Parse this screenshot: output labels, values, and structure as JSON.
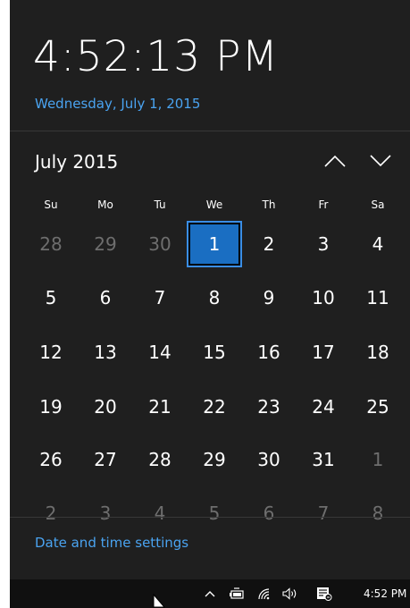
{
  "clock": {
    "time": "4:52:13 PM",
    "date": "Wednesday, July 1, 2015"
  },
  "calendar": {
    "month_title": "July 2015",
    "weekdays": [
      "Su",
      "Mo",
      "Tu",
      "We",
      "Th",
      "Fr",
      "Sa"
    ],
    "weeks": [
      [
        "28",
        "29",
        "30",
        "1",
        "2",
        "3",
        "4"
      ],
      [
        "5",
        "6",
        "7",
        "8",
        "9",
        "10",
        "11"
      ],
      [
        "12",
        "13",
        "14",
        "15",
        "16",
        "17",
        "18"
      ],
      [
        "19",
        "20",
        "21",
        "22",
        "23",
        "24",
        "25"
      ],
      [
        "26",
        "27",
        "28",
        "29",
        "30",
        "31",
        "1"
      ],
      [
        "2",
        "3",
        "4",
        "5",
        "6",
        "7",
        "8"
      ]
    ],
    "selected_day": "1",
    "prev_icon": "chevron-up-icon",
    "next_icon": "chevron-down-icon"
  },
  "footer": {
    "settings_link": "Date and time settings"
  },
  "taskbar": {
    "clock": "4:52 PM",
    "icons": [
      "chevron-up-icon",
      "battery-icon",
      "wifi-icon",
      "volume-icon",
      "notification-icon"
    ]
  },
  "colors": {
    "background": "#1f1f1f",
    "accent": "#1a6ec2",
    "link": "#4aa3f0",
    "dim_text": "#6e6e6e",
    "taskbar": "#101010"
  }
}
